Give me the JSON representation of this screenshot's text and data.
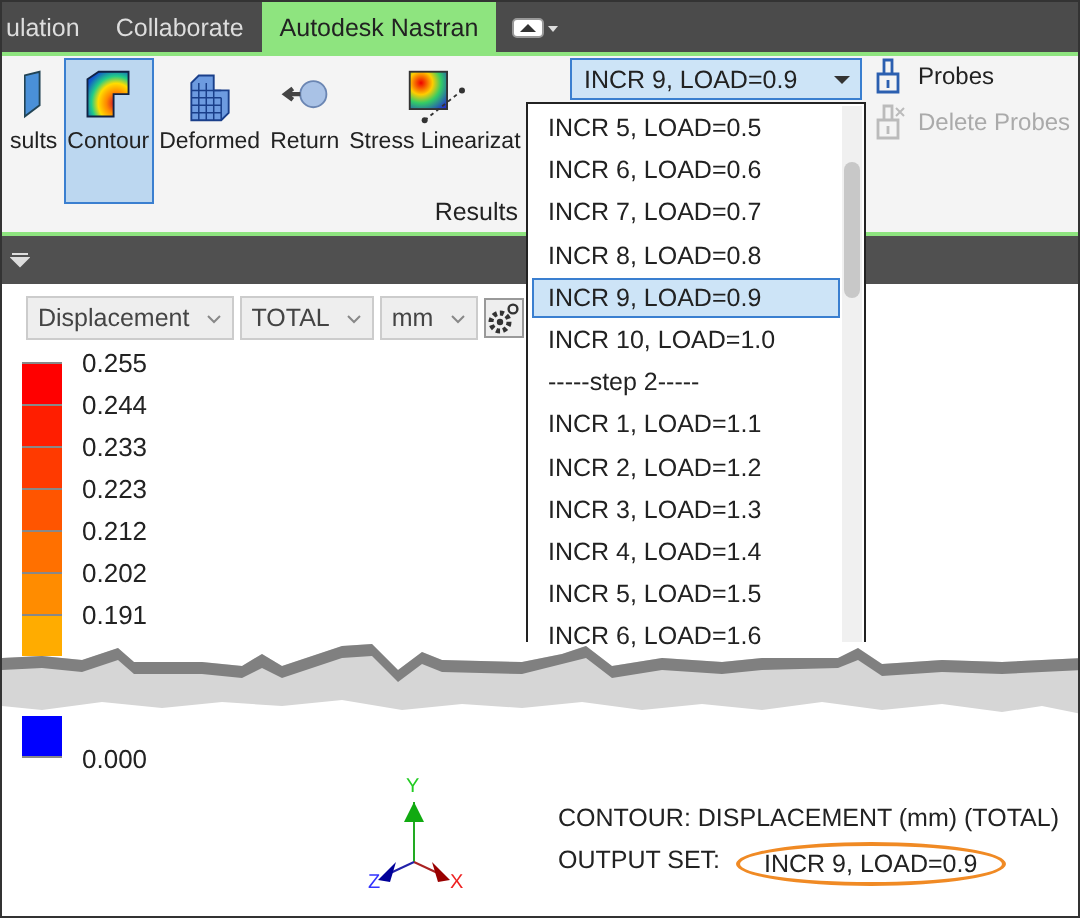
{
  "tabs": [
    {
      "label": "ulation",
      "selected": false
    },
    {
      "label": "Collaborate",
      "selected": false
    },
    {
      "label": "Autodesk Nastran",
      "selected": true
    }
  ],
  "ribbon": {
    "buttons": [
      {
        "label": "sults",
        "kind": "results",
        "selected": false
      },
      {
        "label": "Contour",
        "kind": "contour",
        "selected": true
      },
      {
        "label": "Deformed",
        "kind": "deformed",
        "selected": false
      },
      {
        "label": "Return",
        "kind": "return",
        "selected": false
      },
      {
        "label": "Stress Linearizat",
        "kind": "stress",
        "selected": false
      }
    ],
    "panel_label": "Results",
    "output_set": {
      "value": "INCR 9, LOAD=0.9"
    },
    "probes": [
      {
        "label": "Probes",
        "disabled": false
      },
      {
        "label": "Delete Probes",
        "disabled": true
      }
    ]
  },
  "output_set_list": [
    {
      "label": "INCR 5, LOAD=0.5",
      "selected": false
    },
    {
      "label": "INCR 6, LOAD=0.6",
      "selected": false
    },
    {
      "label": "INCR 7, LOAD=0.7",
      "selected": false
    },
    {
      "label": "INCR 8, LOAD=0.8",
      "selected": false
    },
    {
      "label": "INCR 9, LOAD=0.9",
      "selected": true
    },
    {
      "label": "INCR 10, LOAD=1.0",
      "selected": false
    },
    {
      "label": "-----step 2-----",
      "selected": false
    },
    {
      "label": "INCR 1, LOAD=1.1",
      "selected": false
    },
    {
      "label": "INCR 2, LOAD=1.2",
      "selected": false
    },
    {
      "label": "INCR 3, LOAD=1.3",
      "selected": false
    },
    {
      "label": "INCR 4, LOAD=1.4",
      "selected": false
    },
    {
      "label": "INCR 5, LOAD=1.5",
      "selected": false
    },
    {
      "label": "INCR 6, LOAD=1.6",
      "selected": false
    }
  ],
  "legend": {
    "selectors": [
      "Displacement",
      "TOTAL",
      "mm"
    ],
    "entries": [
      {
        "value": "0.255",
        "color": "#ff0000"
      },
      {
        "value": "0.244",
        "color": "#ff1e00"
      },
      {
        "value": "0.233",
        "color": "#ff3a00"
      },
      {
        "value": "0.223",
        "color": "#ff5500"
      },
      {
        "value": "0.212",
        "color": "#ff7000"
      },
      {
        "value": "0.202",
        "color": "#ff8c00"
      },
      {
        "value": "0.191",
        "color": "#ffac00"
      }
    ],
    "lower_entries": [
      {
        "value": "0.000",
        "color": "#0000ff"
      }
    ]
  },
  "triad": {
    "x": "X",
    "y": "Y",
    "z": "Z"
  },
  "info": {
    "contour": "CONTOUR: DISPLACEMENT (mm) (TOTAL)",
    "output_set_label": "OUTPUT SET:",
    "output_set_value": "INCR 9, LOAD=0.9",
    "highlighted": true
  }
}
